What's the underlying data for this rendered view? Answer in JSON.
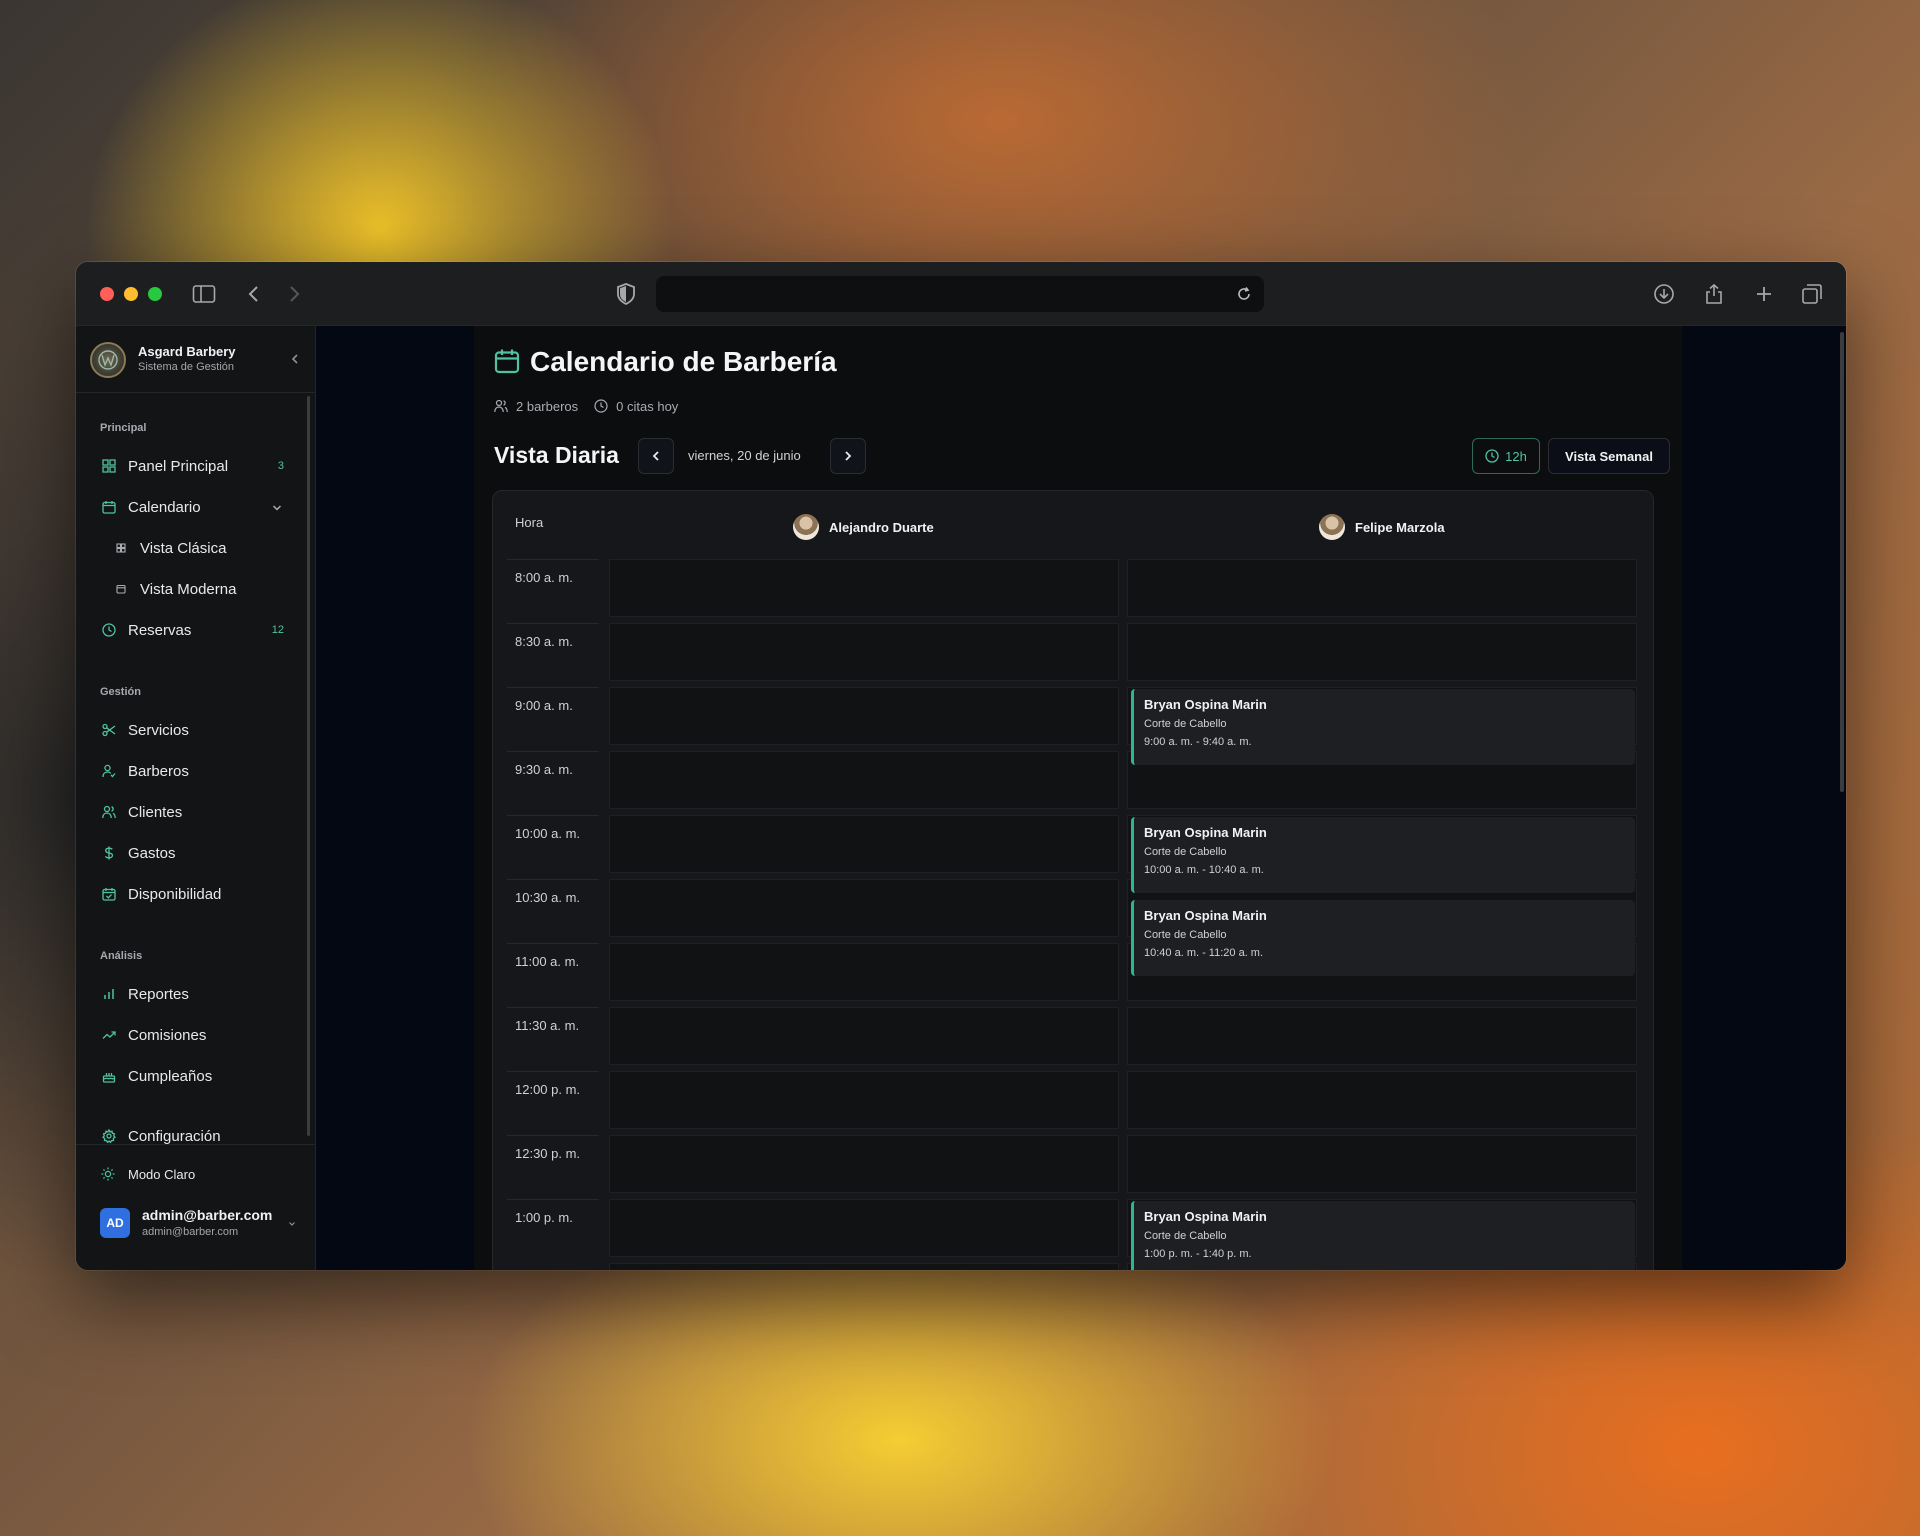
{
  "sidebar": {
    "brand_name": "Asgard Barbery",
    "brand_sub": "Sistema de Gestión",
    "sections": {
      "principal": "Principal",
      "gestion": "Gestión",
      "analisis": "Análisis"
    },
    "items": {
      "panel": {
        "label": "Panel Principal",
        "badge": "3"
      },
      "calendario": {
        "label": "Calendario"
      },
      "vista_clasica": {
        "label": "Vista Clásica"
      },
      "vista_moderna": {
        "label": "Vista Moderna"
      },
      "reservas": {
        "label": "Reservas",
        "badge": "12"
      },
      "servicios": {
        "label": "Servicios"
      },
      "barberos": {
        "label": "Barberos"
      },
      "clientes": {
        "label": "Clientes"
      },
      "gastos": {
        "label": "Gastos"
      },
      "disponibilidad": {
        "label": "Disponibilidad"
      },
      "reportes": {
        "label": "Reportes"
      },
      "comisiones": {
        "label": "Comisiones"
      },
      "cumpleanos": {
        "label": "Cumpleaños"
      },
      "configuracion": {
        "label": "Configuración"
      }
    },
    "mode_label": "Modo Claro",
    "user": {
      "initials": "AD",
      "email": "admin@barber.com",
      "email_sub": "admin@barber.com"
    }
  },
  "page": {
    "title": "Calendario de Barbería",
    "barbers_count": "2 barberos",
    "appointments_today": "0 citas hoy",
    "view_title": "Vista Diaria",
    "date_label": "viernes, 20 de junio",
    "hour_format": "12h",
    "week_view_label": "Vista Semanal"
  },
  "calendar": {
    "hora_label": "Hora",
    "barbers": [
      "Alejandro Duarte",
      "Felipe Marzola"
    ],
    "times": [
      "8:00 a. m.",
      "8:30 a. m.",
      "9:00 a. m.",
      "9:30 a. m.",
      "10:00 a. m.",
      "10:30 a. m.",
      "11:00 a. m.",
      "11:30 a. m.",
      "12:00 p. m.",
      "12:30 p. m.",
      "1:00 p. m."
    ],
    "appointments": [
      {
        "client": "Bryan Ospina Marin",
        "service": "Corte de Cabello",
        "time": "9:00 a. m. - 9:40 a. m."
      },
      {
        "client": "Bryan Ospina Marin",
        "service": "Corte de Cabello",
        "time": "10:00 a. m. - 10:40 a. m."
      },
      {
        "client": "Bryan Ospina Marin",
        "service": "Corte de Cabello",
        "time": "10:40 a. m. - 11:20 a. m."
      },
      {
        "client": "Bryan Ospina Marin",
        "service": "Corte de Cabello",
        "time": "1:00 p. m. - 1:40 p. m."
      }
    ]
  },
  "colors": {
    "accent": "#4fc3a1",
    "appointment_border": "#2db88a",
    "avatar_user": "#2f6fe0"
  }
}
